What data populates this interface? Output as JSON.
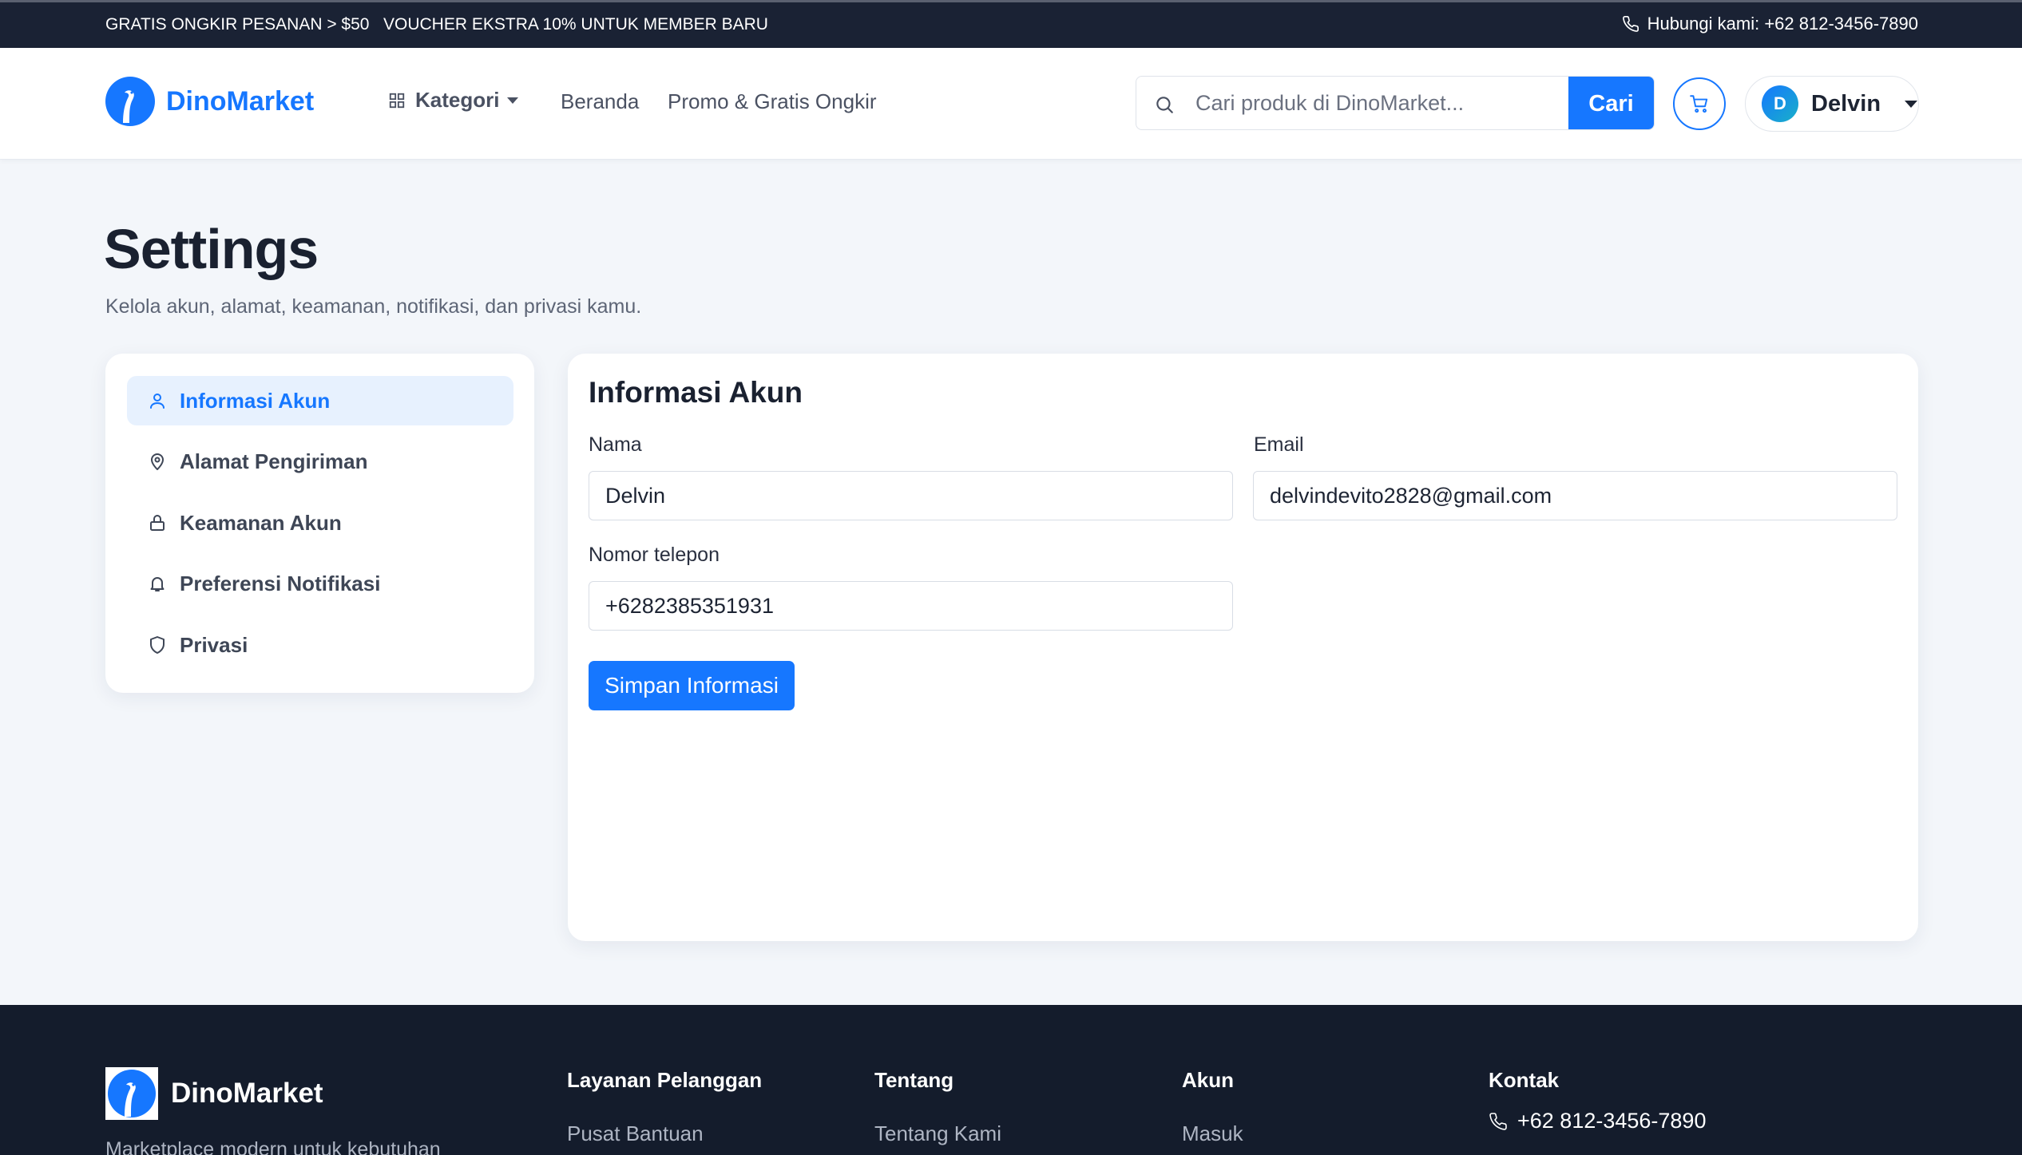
{
  "topbar": {
    "promo_shipping": "GRATIS ONGKIR PESANAN > $50",
    "promo_voucher": "VOUCHER EKSTRA 10% UNTUK MEMBER BARU",
    "contact": "Hubungi kami: +62 812-3456-7890"
  },
  "header": {
    "brand": "DinoMarket",
    "category_label": "Kategori",
    "nav_home": "Beranda",
    "nav_promo": "Promo & Gratis Ongkir",
    "search_placeholder": "Cari produk di DinoMarket...",
    "search_button": "Cari",
    "user_initial": "D",
    "user_name": "Delvin"
  },
  "page": {
    "title": "Settings",
    "subtitle": "Kelola akun, alamat, keamanan, notifikasi, dan privasi kamu."
  },
  "sidebar": {
    "items": [
      {
        "label": "Informasi Akun",
        "icon": "user-icon",
        "active": true
      },
      {
        "label": "Alamat Pengiriman",
        "icon": "map-pin-icon",
        "active": false
      },
      {
        "label": "Keamanan Akun",
        "icon": "lock-icon",
        "active": false
      },
      {
        "label": "Preferensi Notifikasi",
        "icon": "bell-icon",
        "active": false
      },
      {
        "label": "Privasi",
        "icon": "shield-icon",
        "active": false
      }
    ]
  },
  "form": {
    "title": "Informasi Akun",
    "name_label": "Nama",
    "name_value": "Delvin",
    "email_label": "Email",
    "email_value": "delvindevito2828@gmail.com",
    "phone_label": "Nomor telepon",
    "phone_value": "+6282385351931",
    "save_button": "Simpan Informasi"
  },
  "footer": {
    "brand": "DinoMarket",
    "tagline": "Marketplace modern untuk kebutuhan",
    "columns": [
      {
        "title": "Layanan Pelanggan",
        "first_link": "Pusat Bantuan"
      },
      {
        "title": "Tentang",
        "first_link": "Tentang Kami"
      },
      {
        "title": "Akun",
        "first_link": "Masuk"
      },
      {
        "title": "Kontak",
        "first_link": "+62 812-3456-7890"
      }
    ]
  },
  "colors": {
    "accent": "#1677ff",
    "topbar_bg": "#1a2234",
    "footer_bg": "#141c2c",
    "page_bg": "#f3f6fa",
    "active_item_bg": "#e7f1fe"
  }
}
